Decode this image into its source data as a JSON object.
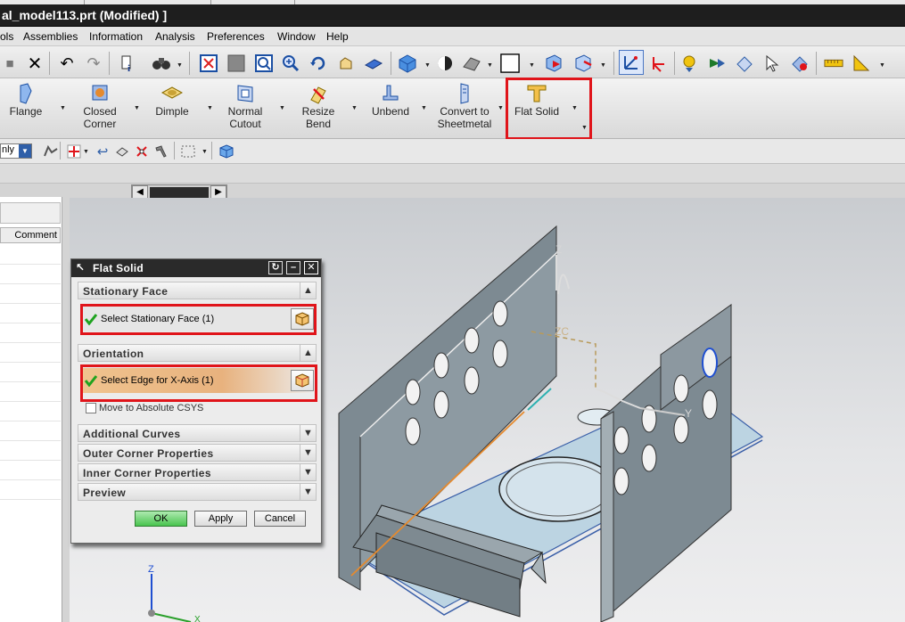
{
  "window": {
    "title": "al_model113.prt (Modified) ]"
  },
  "menu": {
    "items": [
      "ols",
      "Assemblies",
      "Information",
      "Analysis",
      "Preferences",
      "Window",
      "Help"
    ]
  },
  "ribbon": {
    "buttons": [
      {
        "label": "Flange",
        "icon": "flange-icon"
      },
      {
        "label": "Closed\nCorner",
        "icon": "closed-corner-icon"
      },
      {
        "label": "Dimple",
        "icon": "dimple-icon"
      },
      {
        "label": "Normal\nCutout",
        "icon": "normal-cutout-icon"
      },
      {
        "label": "Resize\nBend",
        "icon": "resize-bend-icon"
      },
      {
        "label": "Unbend",
        "icon": "unbend-icon"
      },
      {
        "label": "Convert to\nSheetmetal",
        "icon": "convert-to-sheetmetal-icon"
      },
      {
        "label": "Flat Solid",
        "icon": "flat-solid-icon"
      }
    ],
    "highlight_color": "#e0141a"
  },
  "selection_bar": {
    "filter_value": "nly"
  },
  "navigator": {
    "column_header": "Comment"
  },
  "dialog": {
    "title": "Flat Solid",
    "sections": {
      "stationary_face": "Stationary Face",
      "orientation": "Orientation",
      "additional_curves": "Additional Curves",
      "outer_corner": "Outer Corner Properties",
      "inner_corner": "Inner Corner Properties",
      "preview": "Preview"
    },
    "select_face": "Select Stationary Face (1)",
    "select_edge": "Select Edge for X-Axis (1)",
    "move_to_abs": "Move to Absolute CSYS",
    "buttons": {
      "ok": "OK",
      "apply": "Apply",
      "cancel": "Cancel"
    }
  },
  "model_labels": {
    "z_axis": "Z",
    "zc_label": "ZC",
    "y_label": "Y",
    "csys_z": "Z",
    "csys_x": "X"
  }
}
